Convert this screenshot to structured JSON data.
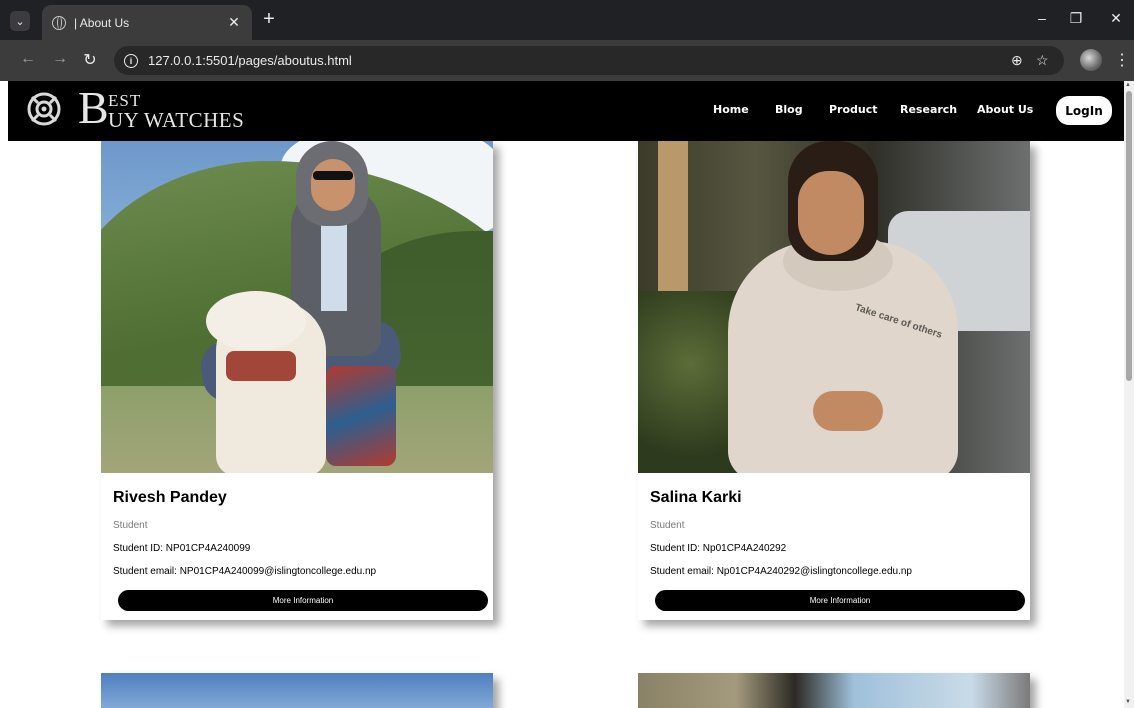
{
  "browser": {
    "tab_title": "| About Us",
    "url": "127.0.0.1:5501/pages/aboutus.html"
  },
  "site": {
    "logo": {
      "big_b": "B",
      "est": "EST",
      "uy_watches": "UY WATCHES"
    },
    "nav": {
      "home": "Home",
      "blog": "Blog",
      "product": "Product",
      "research": "Research",
      "about": "About Us",
      "login": "LogIn"
    }
  },
  "members": [
    {
      "name": "Rivesh Pandey",
      "role": "Student",
      "student_id": "Student ID: NP01CP4A240099",
      "email": "Student email: NP01CP4A240099@islingtoncollege.edu.np",
      "button": "More Information"
    },
    {
      "name": "Salina Karki",
      "role": "Student",
      "student_id": "Student ID: Np01CP4A240292",
      "email": "Student email: Np01CP4A240292@islingtoncollege.edu.np",
      "button": "More Information",
      "photo_print": "Take care of others"
    }
  ]
}
